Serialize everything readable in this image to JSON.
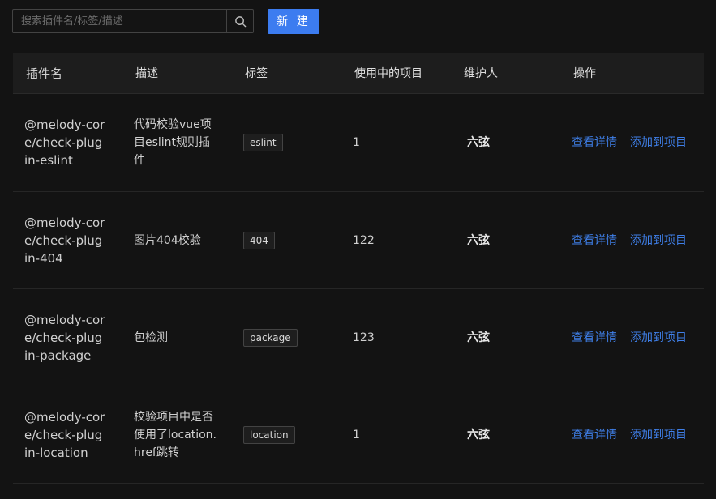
{
  "toolbar": {
    "search_placeholder": "搜索插件名/标签/描述",
    "search_icon": "search-icon",
    "new_label": "新 建",
    "accent": "#3c7cf0"
  },
  "table": {
    "columns": [
      "插件名",
      "描述",
      "标签",
      "使用中的项目",
      "维护人",
      "操作"
    ],
    "rows": [
      {
        "name": "@melody-core/check-plugin-eslint",
        "desc": "代码校验vue项目eslint规则插件",
        "tag": "eslint",
        "count": "1",
        "maintainer": "六弦",
        "action_view": "查看详情",
        "action_add": "添加到项目"
      },
      {
        "name": "@melody-core/check-plugin-404",
        "desc": "图片404校验",
        "tag": "404",
        "count": "122",
        "maintainer": "六弦",
        "action_view": "查看详情",
        "action_add": "添加到项目"
      },
      {
        "name": "@melody-core/check-plugin-package",
        "desc": "包检测",
        "tag": "package",
        "count": "123",
        "maintainer": "六弦",
        "action_view": "查看详情",
        "action_add": "添加到项目"
      },
      {
        "name": "@melody-core/check-plugin-location",
        "desc": "校验项目中是否使用了location.href跳转",
        "tag": "location",
        "count": "1",
        "maintainer": "六弦",
        "action_view": "查看详情",
        "action_add": "添加到项目"
      }
    ]
  }
}
